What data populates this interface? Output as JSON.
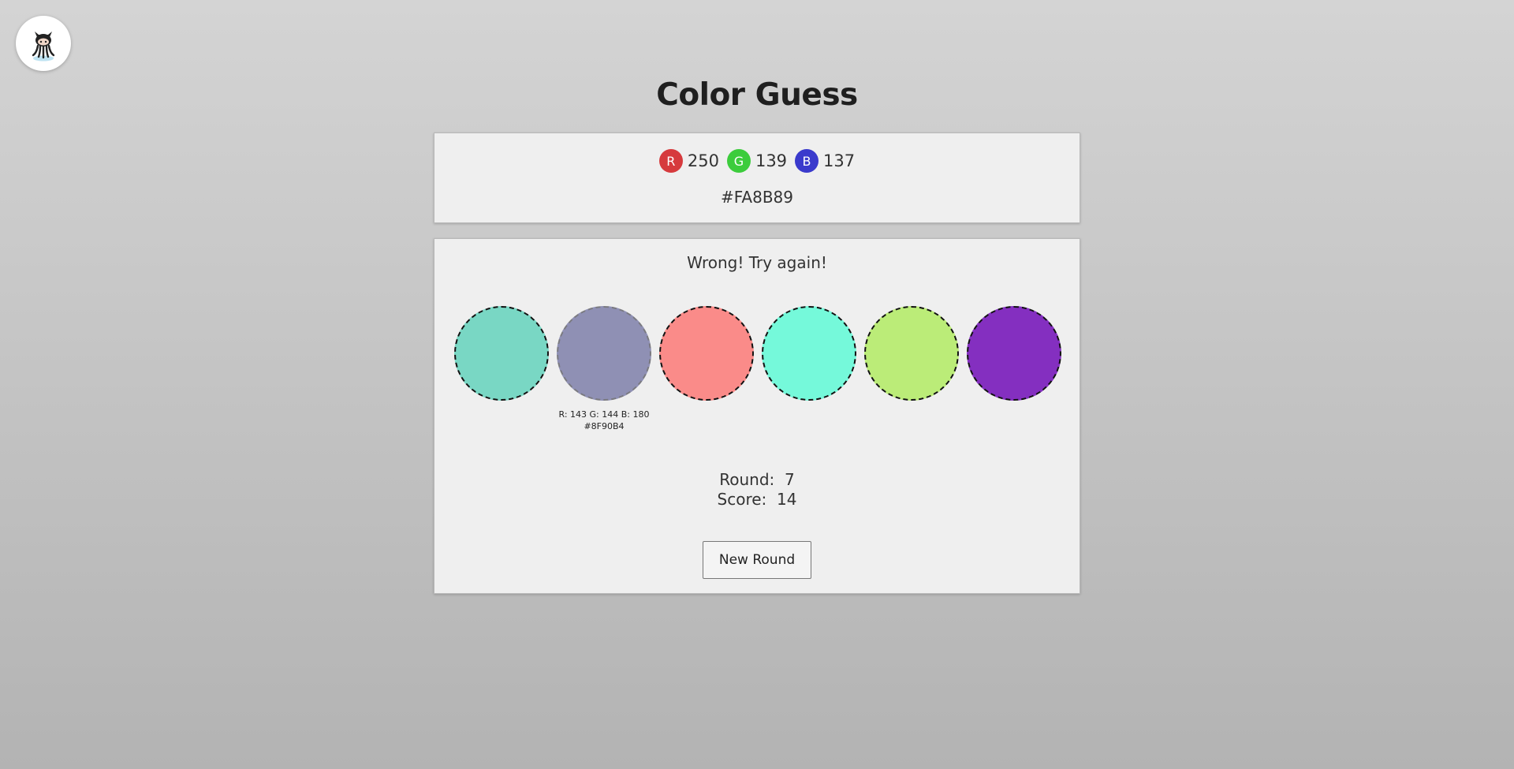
{
  "header": {
    "title": "Color Guess",
    "github_icon": "github-octocat-icon"
  },
  "target": {
    "channels": [
      {
        "letter": "R",
        "value": "250",
        "color": "#d63a3d"
      },
      {
        "letter": "G",
        "value": "139",
        "color": "#3ccc3c"
      },
      {
        "letter": "B",
        "value": "137",
        "color": "#3a3acc"
      }
    ],
    "hex": "#FA8B89"
  },
  "game": {
    "status": "Wrong! Try again!",
    "swatches": [
      {
        "color": "#79d7c4",
        "revealed": false,
        "rgb_label": "",
        "hex_label": ""
      },
      {
        "color": "#8f90b4",
        "revealed": true,
        "rgb_label": "R: 143 G: 144 B: 180",
        "hex_label": "#8F90B4"
      },
      {
        "color": "#fa8b89",
        "revealed": false,
        "rgb_label": "",
        "hex_label": ""
      },
      {
        "color": "#75f9da",
        "revealed": false,
        "rgb_label": "",
        "hex_label": ""
      },
      {
        "color": "#bbec78",
        "revealed": false,
        "rgb_label": "",
        "hex_label": ""
      },
      {
        "color": "#842fc0",
        "revealed": false,
        "rgb_label": "",
        "hex_label": ""
      }
    ],
    "round_label": "Round:",
    "round": "7",
    "score_label": "Score:",
    "score": "14",
    "new_round_label": "New Round"
  }
}
